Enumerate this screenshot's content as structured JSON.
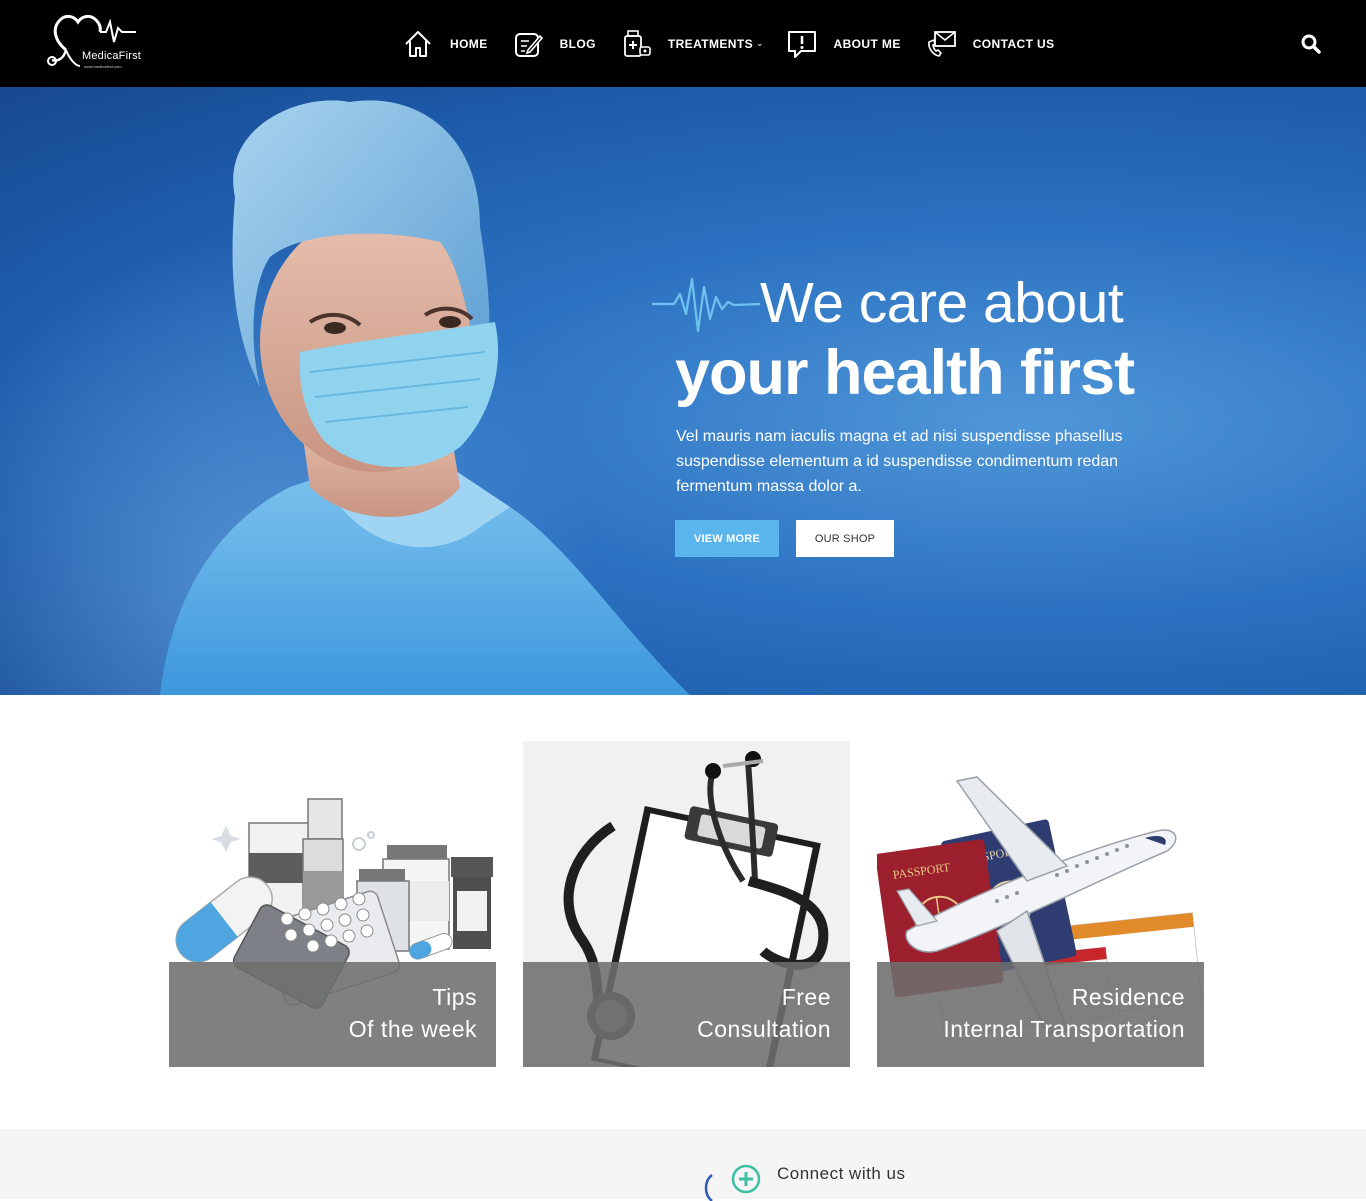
{
  "brand": {
    "name": "MedicaFirst",
    "sub": "www.medicafirst.com"
  },
  "nav": {
    "items": [
      {
        "label": "HOME",
        "icon": "home-icon"
      },
      {
        "label": "BLOG",
        "icon": "blog-icon"
      },
      {
        "label": "TREATMENTS",
        "icon": "treatments-icon",
        "has_dropdown": true
      },
      {
        "label": "ABOUT ME",
        "icon": "about-icon"
      },
      {
        "label": "CONTACT US",
        "icon": "contact-icon"
      }
    ],
    "search_icon": "search-icon"
  },
  "hero": {
    "heading_line1": "We care about",
    "heading_line2": "your health first",
    "description": "Vel mauris nam iaculis magna et ad nisi suspendisse phasellus suspendisse elementum a id suspendisse condimentum redan fermentum massa dolor a.",
    "primary_button": "VIEW MORE",
    "secondary_button": "OUR SHOP",
    "accent_color": "#5ab5ec"
  },
  "cards": [
    {
      "line1": "Tips",
      "line2": "Of the week"
    },
    {
      "line1": "Free",
      "line2": "Consultation"
    },
    {
      "line1": "Residence",
      "line2": "Internal Transportation"
    }
  ],
  "card3_art": {
    "passport_1": "PASSPORT",
    "passport_2": "PASSPORT"
  },
  "connect": {
    "label": "Connect with us"
  }
}
